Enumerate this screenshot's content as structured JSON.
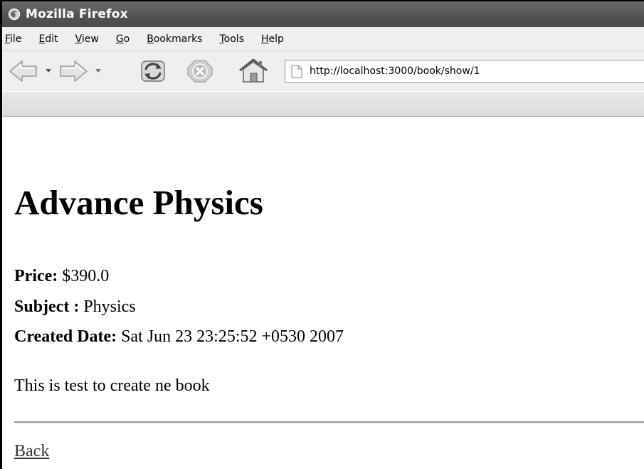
{
  "window": {
    "title": "Mozilla Firefox"
  },
  "menubar": {
    "items": [
      {
        "accel": "F",
        "rest": "ile"
      },
      {
        "accel": "E",
        "rest": "dit"
      },
      {
        "accel": "V",
        "rest": "iew"
      },
      {
        "accel": "G",
        "rest": "o"
      },
      {
        "accel": "B",
        "rest": "ookmarks"
      },
      {
        "accel": "T",
        "rest": "ools"
      },
      {
        "accel": "H",
        "rest": "elp"
      }
    ]
  },
  "navbar": {
    "url": "http://localhost:3000/book/show/1"
  },
  "page": {
    "title": "Advance Physics",
    "price_label": "Price:",
    "price_value": " $390.0",
    "subject_label": "Subject :",
    "subject_value": " Physics",
    "created_label": "Created Date:",
    "created_value": " Sat Jun 23 23:25:52 +0530 2007",
    "description": "This is test to create ne book",
    "back_link": "Back"
  },
  "colors": {
    "titlebar": "#535353",
    "toolbar": "#efefef",
    "link": "#333333"
  }
}
